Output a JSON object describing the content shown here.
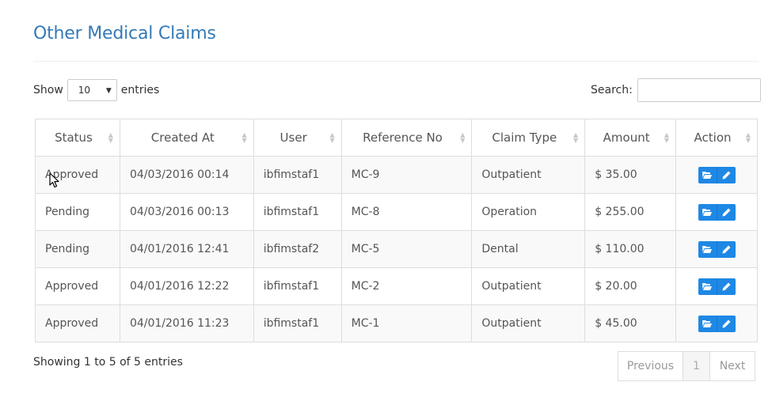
{
  "page": {
    "title": "Other Medical Claims"
  },
  "length_control": {
    "prefix": "Show",
    "selected": "10",
    "suffix": "entries"
  },
  "search": {
    "label": "Search:",
    "value": ""
  },
  "table": {
    "columns": [
      "Status",
      "Created At",
      "User",
      "Reference No",
      "Claim Type",
      "Amount",
      "Action"
    ],
    "rows": [
      [
        "Approved",
        "04/03/2016 00:14",
        "ibfimstaf1",
        "MC-9",
        "Outpatient",
        "$ 35.00"
      ],
      [
        "Pending",
        "04/03/2016 00:13",
        "ibfimstaf1",
        "MC-8",
        "Operation",
        "$ 255.00"
      ],
      [
        "Pending",
        "04/01/2016 12:41",
        "ibfimstaf2",
        "MC-5",
        "Dental",
        "$ 110.00"
      ],
      [
        "Approved",
        "04/01/2016 12:22",
        "ibfimstaf1",
        "MC-2",
        "Outpatient",
        "$ 20.00"
      ],
      [
        "Approved",
        "04/01/2016 11:23",
        "ibfimstaf1",
        "MC-1",
        "Outpatient",
        "$ 45.00"
      ]
    ],
    "row_actions": [
      "folder-open-icon",
      "pencil-icon"
    ]
  },
  "footer": {
    "info": "Showing 1 to 5 of 5 entries",
    "pagination": {
      "previous": "Previous",
      "current": "1",
      "next": "Next"
    }
  },
  "colors": {
    "title": "#337ab7",
    "action_button": "#1e88e5",
    "border": "#dddddd",
    "stripe": "#f9f9f9"
  }
}
